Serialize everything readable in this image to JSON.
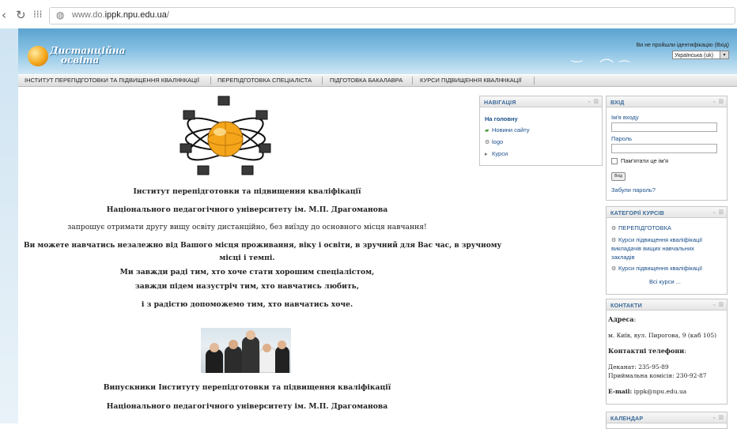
{
  "browser": {
    "url_prefix": "www.do.",
    "url_domain": "ippk.npu.edu.ua",
    "url_suffix": "/"
  },
  "header": {
    "logo_line1": "Дистанційна",
    "logo_line2": "освіта",
    "login_status": "Ви не пройшли ідентифікацію (Вхід)",
    "language": "Українська (uk)"
  },
  "menu": [
    "ІНСТИТУТ ПЕРЕПІДГОТОВКИ ТА ПІДВИЩЕННЯ КВАЛІФІКАЦІЇ",
    "ПЕРЕПІДГОТОВКА СПЕЦІАЛІСТА",
    "ПІДГОТОВКА БАКАЛАВРА",
    "КУРСИ ПІДВИЩЕННЯ КВАЛІФІКАЦІЇ"
  ],
  "content": {
    "line1": "Інститут перепідготовки та підвищення кваліфікації",
    "line2": "Національного педагогічного університету ім. М.П. Драгоманова",
    "line3": "запрошує отримати другу вищу освіту дистанційно, без виїзду до основного місця навчання!",
    "line4": "Ви можете навчатись незалежно від Вашого місця проживання, віку і освіти, в зручний для Вас час, в зручному",
    "line5": "місці і темпі.",
    "line6": "Ми завжди раді тим, хто хоче стати хорошим спеціалістом,",
    "line7": "завжди підем назустріч тим, хто навчатись любить,",
    "line8": "і з радістю допоможемо тим, хто навчатись хоче.",
    "line9": "Випускники Інституту перепідготовки та підвищення кваліфікації",
    "line10": "Національного педагогічного університету ім. М.П. Драгоманова"
  },
  "navigation": {
    "title": "НАВІГАЦІЯ",
    "home": "На головну",
    "news": "Новини сайту",
    "logo": "logo",
    "courses": "Курси"
  },
  "login": {
    "title": "ВХІД",
    "username_label": "Ім'я входу",
    "password_label": "Пароль",
    "remember": "Пам'ятати це ім'я",
    "submit": "Вхід",
    "forgot": "Забули пароль?"
  },
  "categories": {
    "title": "КАТЕГОРІЇ КУРСІВ",
    "item1": "ПЕРЕПІДГОТОВКА",
    "item2_l1": "Курси підвищення кваліфікації",
    "item2_l2": "викладачів вищих навчальних",
    "item2_l3": "закладів",
    "item3": "Курси підвищення кваліфікації",
    "all": "Всі курси ..."
  },
  "contacts": {
    "title": "КОНТАКТИ",
    "address_label": "Адреса",
    "address": "м. Київ, вул. Пирогова, 9 (каб 105)",
    "phones_label": "Контактні телефони",
    "dean": "Деканат: 235-95-89",
    "admissions": "Приймальна комісія: 230-92-87",
    "email_label": "E-mail:",
    "email": "ippk@npu.edu.ua"
  },
  "calendar": {
    "title": "КАЛЕНДАР"
  }
}
